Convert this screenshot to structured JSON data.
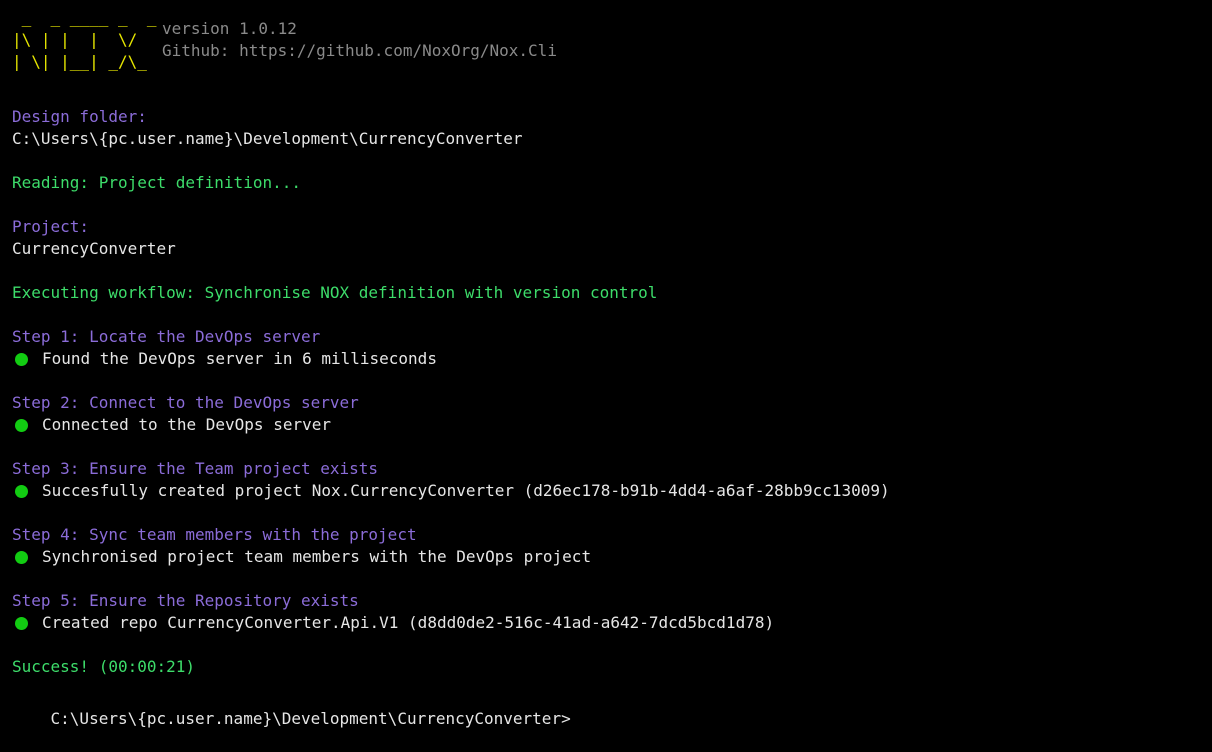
{
  "window": {
    "background": "#000000"
  },
  "colors": {
    "logo": "#e6e600",
    "info": "#8a8a8a",
    "heading": "#8b6cd8",
    "success": "#3ddc6a",
    "text": "#e6e6e6",
    "status_dot": "#12cc12"
  },
  "header": {
    "logo_ascii": " _  _ ____ _  _\n|\\ | |  |  \\/\n| \\| |__| _/\\_",
    "version": "version 1.0.12",
    "github": "Github: https://github.com/NoxOrg/Nox.Cli"
  },
  "design_folder": {
    "label": "Design folder:",
    "path": "C:\\Users\\{pc.user.name}\\Development\\CurrencyConverter"
  },
  "reading": "Reading: Project definition...",
  "project": {
    "label": "Project:",
    "name": "CurrencyConverter"
  },
  "workflow": "Executing workflow: Synchronise NOX definition with version control",
  "steps": [
    {
      "title": "Step 1: Locate the DevOps server",
      "status_icon": "green-dot-icon",
      "result": "Found the DevOps server in 6 milliseconds"
    },
    {
      "title": "Step 2: Connect to the DevOps server",
      "status_icon": "green-dot-icon",
      "result": "Connected to the DevOps server"
    },
    {
      "title": "Step 3: Ensure the Team project exists",
      "status_icon": "green-dot-icon",
      "result": "Succesfully created project Nox.CurrencyConverter (d26ec178-b91b-4dd4-a6af-28bb9cc13009)"
    },
    {
      "title": "Step 4: Sync team members with the project",
      "status_icon": "green-dot-icon",
      "result": "Synchronised project team members with the DevOps project"
    },
    {
      "title": "Step 5: Ensure the Repository exists",
      "status_icon": "green-dot-icon",
      "result": "Created repo CurrencyConverter.Api.V1 (d8dd0de2-516c-41ad-a642-7dcd5bcd1d78)"
    }
  ],
  "summary": "Success! (00:00:21)",
  "prompt": "C:\\Users\\{pc.user.name}\\Development\\CurrencyConverter>"
}
